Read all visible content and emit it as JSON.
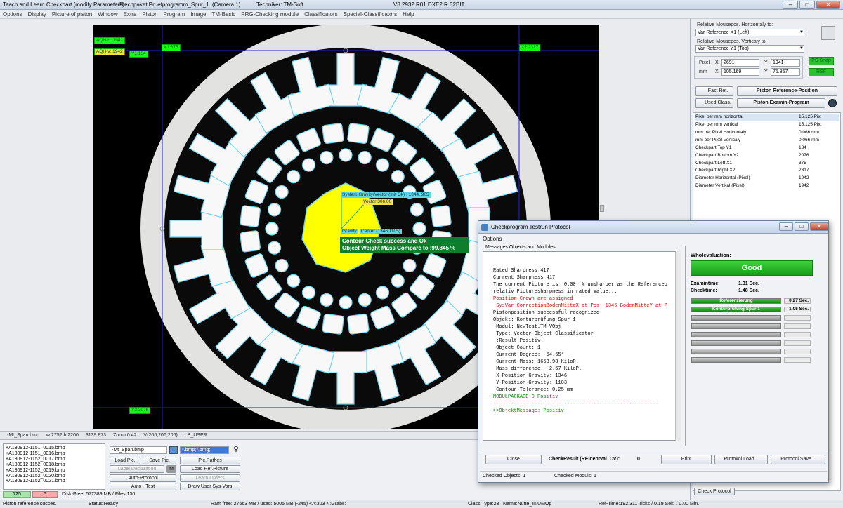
{
  "title": {
    "app": "Teach and Learn Checkpart (modify Parameters):",
    "file": "Blechpaket Pruefprogramm_Spur_1",
    "camera": "(Camera 1)",
    "tech": "Techniker: TM-Soft",
    "version": "V8.2932.R01 DXE2 R 32BIT"
  },
  "menu": [
    "Options",
    "Display",
    "Picture of piston",
    "Window",
    "Extra",
    "Piston",
    "Program",
    "Image",
    "TM-Basic",
    "PRG-Checking module",
    "Classificators",
    "Special-Classificators",
    "Help"
  ],
  "overlay": {
    "aqh": "AQH-h: 1942",
    "aqv": "AQH-v: 1942",
    "y1": "Y1:134",
    "x1": "X1:375",
    "x2": "X2:2317",
    "y2": "Y2:2076",
    "gvector": "System:Gravity/Vector (Init Ok) : 1344, 905",
    "vector": "Vector 306.00",
    "gravity": "Gravity",
    "center": "Center (1346,1105)",
    "msg1": "Contour Check success and Ok",
    "msg2": "Object Weight Mass Compare to :99.845 %"
  },
  "imgstatus": [
    "-Mt_Span.bmp",
    "w:2752 h:2200",
    "3139:873",
    "Zoom:0.42",
    "V(206,206,206)",
    "LB_USER"
  ],
  "files": [
    "+A130912-1151_0015.bmp",
    "+A130912-1151_0016.bmp",
    "+A130912-1152_0017.bmp",
    "+A130912-1152_0018.bmp",
    "+A130912-1152_0019.bmp",
    "+A130912-1152_0020.bmp",
    "+A130912-1152_0021.bmp"
  ],
  "counts": {
    "a": "125",
    "b": "5"
  },
  "disk": "Disk-Free: 577389 MB / Files:130",
  "bottom": {
    "filename": "-Mt_Span.bmp",
    "filter": "*.bmp;*.bmg;",
    "load": "Load Pic.",
    "save": "Save Pic.",
    "pathes": "Pic.Pathes",
    "labeldecl": "Label Declaration",
    "m": "M",
    "loadref": "Load Ref.Picture",
    "autoprot": "Auto-Protocol",
    "learn": "Learn Orders",
    "autotest": "Auto - Test",
    "drawuser": "Draw User Sys-Vars"
  },
  "status": {
    "s1": "Piston reference succes.",
    "s2": "Status:Ready",
    "s3": "Ram free: 27663 MB / used: 5005 MB (-245) <A:303 N:Grabs:",
    "s4": "Class.Type:23",
    "s5": "Name:Nutte_III.UMOp",
    "s6": "Ref-Time:192.311 Ticks / 0.19 Sek. / 0.00 Min."
  },
  "right": {
    "relh": "Relative Mousepos. Horizontaly to:",
    "relh_val": "Var Reference X1 (Left)",
    "relv": "Relative Mousepos. Verticaly to:",
    "relv_val": "Var Reference Y1 (Top)",
    "pixel": "Pixel",
    "mm": "mm",
    "x": "X",
    "y": "Y",
    "px": "2691",
    "py": "1941",
    "mx": "105.169",
    "my": "75.857",
    "snap": "PS Snap",
    "ref": "REF",
    "fastref": "Fast Ref.",
    "pistonref": "Piston Reference-Position",
    "usedclass": "Used Class.",
    "pistonexam": "Piston Examin-Program",
    "checkprot": "Check Protocol"
  },
  "params": [
    {
      "n": "Pixel per mm horizontal",
      "v": "15.125 Pix."
    },
    {
      "n": "Pixel per mm vertical",
      "v": "15.125 Pix."
    },
    {
      "n": "mm per Pixel Horicontaly",
      "v": "0.066 mm"
    },
    {
      "n": "mm per Pixel Verticaly",
      "v": "0.066 mm"
    },
    {
      "n": "Checkpart Top Y1",
      "v": "134"
    },
    {
      "n": "Checkpart Bottom Y2",
      "v": "2076"
    },
    {
      "n": "Checkpart Left X1",
      "v": "375"
    },
    {
      "n": "Checkpart Right X2",
      "v": "2317"
    },
    {
      "n": "Diameter Horizontal (Pixel)",
      "v": "1942"
    },
    {
      "n": "Diameter Vertikal (Pixel)",
      "v": "1942"
    }
  ],
  "dialog": {
    "title": "Checkprogram Testrun Protocol",
    "options": "Options",
    "msgs": "Messages Objects and Modules",
    "lines": [
      {
        "t": "Rated Sharpness 417",
        "c": ""
      },
      {
        "t": "Current Sharpness 417",
        "c": ""
      },
      {
        "t": "The current Picture is  0.00  % unsharper as the Referencep",
        "c": ""
      },
      {
        "t": "relativ Picturesharpness in rated Value...",
        "c": ""
      },
      {
        "t": "",
        "c": ""
      },
      {
        "t": "Position Crown are assigned",
        "c": "red"
      },
      {
        "t": " SysVar-CorrectionBodenMitteX at Pos. 1346 BodenMitteY at P",
        "c": "red"
      },
      {
        "t": "Pistonposition successful recognized",
        "c": ""
      },
      {
        "t": "",
        "c": ""
      },
      {
        "t": "Objekt: Konturprüfung Spur 1",
        "c": ""
      },
      {
        "t": " Modul: NewTest.TM-VObj",
        "c": ""
      },
      {
        "t": "",
        "c": ""
      },
      {
        "t": " Type: Vector Object Classificator",
        "c": ""
      },
      {
        "t": " :Result Positiv",
        "c": ""
      },
      {
        "t": "",
        "c": ""
      },
      {
        "t": " Object Count: 1",
        "c": ""
      },
      {
        "t": " Current Degree: -54.65°",
        "c": ""
      },
      {
        "t": " Current Mass: 1653.98 KiloP.",
        "c": ""
      },
      {
        "t": " Mass difference: -2.57 KiloP.",
        "c": ""
      },
      {
        "t": " X-Position Gravity: 1346",
        "c": ""
      },
      {
        "t": " Y-Position Gravity: 1103",
        "c": ""
      },
      {
        "t": " Contour Tolerance: 0.25 mm",
        "c": ""
      },
      {
        "t": "MODULPACKAGE 0 Positiv",
        "c": "green"
      },
      {
        "t": "--------------------------------------------------------",
        "c": "green"
      },
      {
        "t": ">>ObjektMessage: Positiv",
        "c": "green"
      }
    ],
    "whole": "Wholevaluation:",
    "good": "Good",
    "examtime": "Examintime:",
    "examval": "1.31 Sec.",
    "checktime": "Checktime:",
    "checkval": "1.48 Sec.",
    "bar1": "Referenzierung",
    "bar1v": "0.27 Sec.",
    "bar2": "Konturprüfung Spur 1",
    "bar2v": "1.05 Sec.",
    "close": "Close",
    "checkresult": "CheckResult (REIdentval. CV):",
    "crval": "0",
    "print": "Print",
    "pload": "Protokol  Load...",
    "psave": "Protocol Save...",
    "cobj": "Checked Objects: 1",
    "cmod": "Checked Moduls: 1"
  },
  "colors": {
    "bar_green": "#22a722",
    "overlay_green": "#12ff12",
    "yellow": "#ffff00"
  }
}
